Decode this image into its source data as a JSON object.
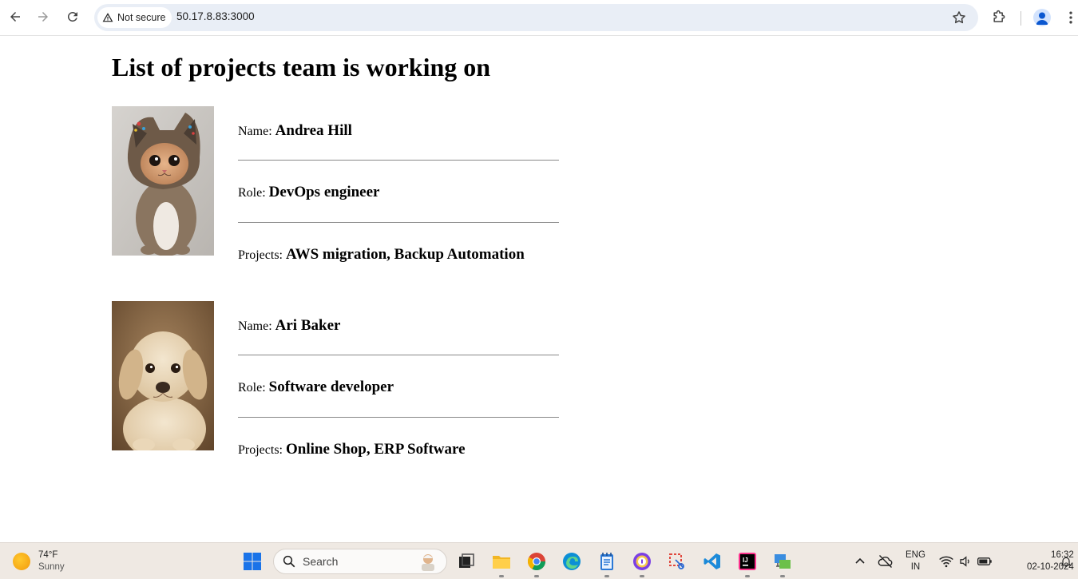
{
  "browser": {
    "security_label": "Not secure",
    "url": "50.17.8.83:3000"
  },
  "page": {
    "title": "List of projects team is working on",
    "members": [
      {
        "name_label": "Name:",
        "name": "Andrea Hill",
        "role_label": "Role:",
        "role": "DevOps engineer",
        "projects_label": "Projects:",
        "projects": "AWS migration, Backup Automation",
        "photo": "kitten-in-hood"
      },
      {
        "name_label": "Name:",
        "name": "Ari Baker",
        "role_label": "Role:",
        "role": "Software developer",
        "projects_label": "Projects:",
        "projects": "Online Shop, ERP Software",
        "photo": "golden-puppy"
      }
    ]
  },
  "taskbar": {
    "weather_temp": "74°F",
    "weather_condition": "Sunny",
    "search_placeholder": "Search",
    "lang_line1": "ENG",
    "lang_line2": "IN",
    "time": "16:32",
    "date": "02-10-2024"
  },
  "colors": {
    "omnibox": "#e9eef6",
    "taskbar": "#efe9e3",
    "accent_blue": "#0b57d0"
  }
}
